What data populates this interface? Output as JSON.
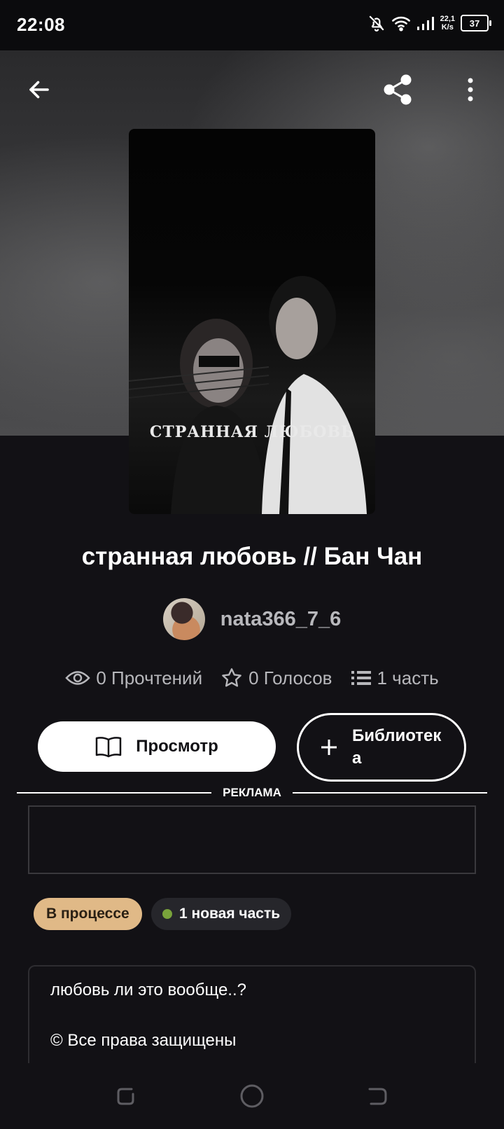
{
  "status_bar": {
    "time": "22:08",
    "net_speed_value": "22,1",
    "net_speed_unit": "K/s",
    "battery": "37",
    "icons": [
      "bell-off-icon",
      "wifi-icon",
      "signal-icon",
      "battery-icon"
    ]
  },
  "top_bar": {
    "icons": [
      "back-arrow-icon",
      "share-icon",
      "more-vert-icon"
    ]
  },
  "cover": {
    "overlay_text": "СТРАННАЯ ЛЮБОВЬ"
  },
  "book": {
    "title": "странная любовь // Бан Чан",
    "author": "nata366_7_6"
  },
  "stats": {
    "reads": "0 Прочтений",
    "votes": "0 Голосов",
    "parts": "1 часть"
  },
  "actions": {
    "read_label": "Просмотр",
    "library_label": "Библиотека"
  },
  "ad": {
    "label": "РЕКЛАМА"
  },
  "tags": {
    "status": "В процессе",
    "new_parts": "1 новая часть"
  },
  "description": {
    "line1": "любовь ли это вообще..?",
    "line2": "© Все права защищены"
  },
  "colors": {
    "background": "#121115",
    "status_tag": "#e0b987",
    "new_dot": "#79a33b"
  }
}
